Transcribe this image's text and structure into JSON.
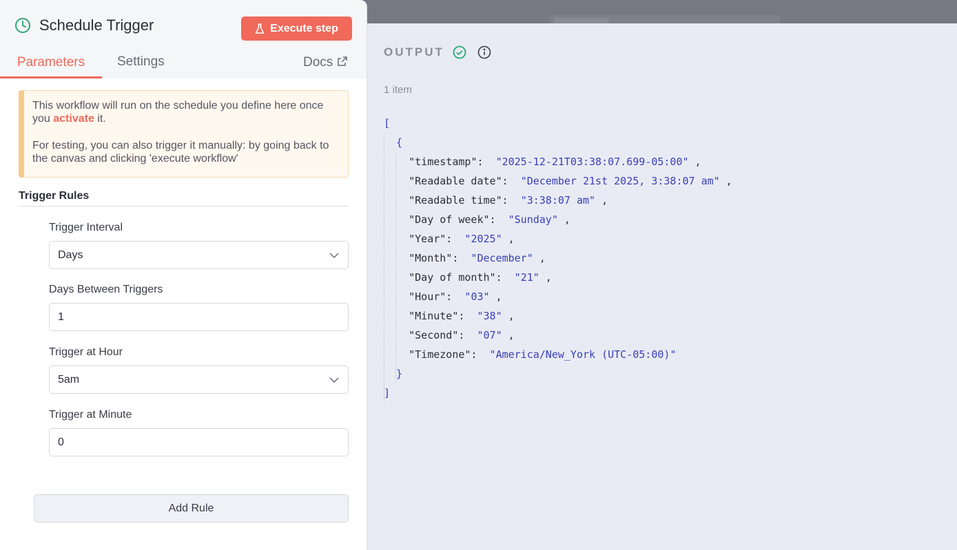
{
  "panel": {
    "title": "Schedule Trigger",
    "execute_label": "Execute step",
    "tabs": {
      "parameters": "Parameters",
      "settings": "Settings",
      "docs": "Docs"
    },
    "notice": {
      "line1_pre": "This workflow will run on the schedule you define here once you ",
      "line1_link": "activate",
      "line1_post": " it.",
      "line2": "For testing, you can also trigger it manually: by going back to the canvas and clicking 'execute workflow'"
    },
    "section_title": "Trigger Rules",
    "fields": {
      "interval_label": "Trigger Interval",
      "interval_value": "Days",
      "days_label": "Days Between Triggers",
      "days_value": "1",
      "hour_label": "Trigger at Hour",
      "hour_value": "5am",
      "minute_label": "Trigger at Minute",
      "minute_value": "0"
    },
    "add_rule_label": "Add Rule"
  },
  "output": {
    "title": "OUTPUT",
    "item_count": "1 item",
    "items": [
      {
        "key": "timestamp",
        "value": "2025-12-21T03:38:07.699-05:00"
      },
      {
        "key": "Readable date",
        "value": "December 21st 2025, 3:38:07 am"
      },
      {
        "key": "Readable time",
        "value": "3:38:07 am"
      },
      {
        "key": "Day of week",
        "value": "Sunday"
      },
      {
        "key": "Year",
        "value": "2025"
      },
      {
        "key": "Month",
        "value": "December"
      },
      {
        "key": "Day of month",
        "value": "21"
      },
      {
        "key": "Hour",
        "value": "03"
      },
      {
        "key": "Minute",
        "value": "38"
      },
      {
        "key": "Second",
        "value": "07"
      },
      {
        "key": "Timezone",
        "value": "America/New_York (UTC-05:00)"
      }
    ]
  },
  "colors": {
    "accent": "#f0695a",
    "success": "#2aa874",
    "json_value": "#3a3fb8"
  }
}
